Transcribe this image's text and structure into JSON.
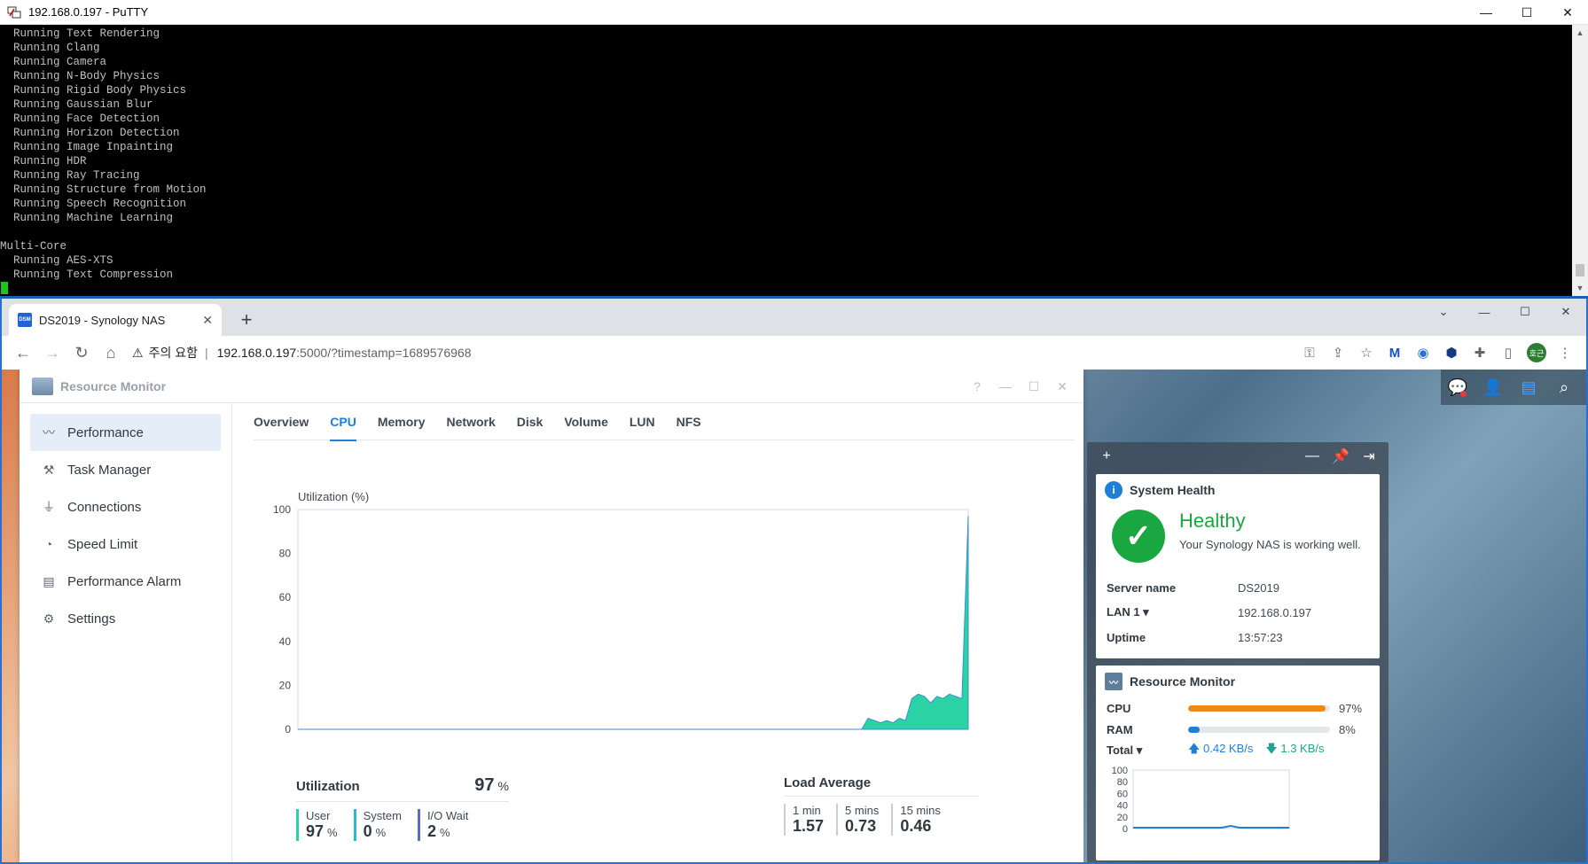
{
  "putty": {
    "title": "192.168.0.197 - PuTTY",
    "terminal_lines": [
      "  Running Text Rendering",
      "  Running Clang",
      "  Running Camera",
      "  Running N-Body Physics",
      "  Running Rigid Body Physics",
      "  Running Gaussian Blur",
      "  Running Face Detection",
      "  Running Horizon Detection",
      "  Running Image Inpainting",
      "  Running HDR",
      "  Running Ray Tracing",
      "  Running Structure from Motion",
      "  Running Speech Recognition",
      "  Running Machine Learning",
      "",
      "Multi-Core",
      "  Running AES-XTS",
      "  Running Text Compression"
    ],
    "controls": {
      "minimize": "—",
      "maximize": "☐",
      "close": "✕"
    }
  },
  "browser": {
    "tab_title": "DS2019 - Synology NAS",
    "tab_favicon": "DSM",
    "tab_close": "✕",
    "new_tab": "+",
    "security_warning": "주의 요함",
    "url_host": "192.168.0.197",
    "url_path": ":5000/?timestamp=1689576968",
    "profile_initials": "호근",
    "controls": {
      "tabsearch": "⌄",
      "minimize": "—",
      "maximize": "☐",
      "close": "✕"
    }
  },
  "resource_monitor": {
    "title": "Resource Monitor",
    "window_controls": {
      "help": "?",
      "minimize": "—",
      "maximize": "☐",
      "close": "✕"
    },
    "sidebar": [
      {
        "label": "Performance",
        "icon": "chart-icon",
        "active": true
      },
      {
        "label": "Task Manager",
        "icon": "task-icon",
        "active": false
      },
      {
        "label": "Connections",
        "icon": "plug-icon",
        "active": false
      },
      {
        "label": "Speed Limit",
        "icon": "gauge-icon",
        "active": false
      },
      {
        "label": "Performance Alarm",
        "icon": "alarm-icon",
        "active": false
      },
      {
        "label": "Settings",
        "icon": "gear-icon",
        "active": false
      }
    ],
    "tabs": [
      "Overview",
      "CPU",
      "Memory",
      "Network",
      "Disk",
      "Volume",
      "LUN",
      "NFS"
    ],
    "active_tab": "CPU",
    "utilization": {
      "label": "Utilization",
      "value": "97",
      "unit": "%",
      "user_label": "User",
      "user_value": "97",
      "user_unit": "%",
      "system_label": "System",
      "system_value": "0",
      "system_unit": "%",
      "iowait_label": "I/O Wait",
      "iowait_value": "2",
      "iowait_unit": "%"
    },
    "load_average": {
      "label": "Load Average",
      "items": [
        {
          "label": "1 min",
          "value": "1.57"
        },
        {
          "label": "5 mins",
          "value": "0.73"
        },
        {
          "label": "15 mins",
          "value": "0.46"
        }
      ]
    }
  },
  "widgets": {
    "system_health": {
      "title": "System Health",
      "status": "Healthy",
      "description": "Your Synology NAS is working well.",
      "server_name_label": "Server name",
      "server_name": "DS2019",
      "lan_label": "LAN 1 ▾",
      "lan_value": "192.168.0.197",
      "uptime_label": "Uptime",
      "uptime_value": "13:57:23"
    },
    "resource_monitor": {
      "title": "Resource Monitor",
      "cpu_label": "CPU",
      "cpu_value": "97%",
      "cpu_fraction": 0.97,
      "ram_label": "RAM",
      "ram_value": "8%",
      "ram_fraction": 0.08,
      "total_label": "Total ▾",
      "upload": "0.42 KB/s",
      "download": "1.3 KB/s",
      "chart_y_ticks": [
        "100",
        "80",
        "60",
        "40",
        "20",
        "0"
      ]
    }
  },
  "colors": {
    "accent": "#1f7fd6",
    "cpu_bar": "#f0891a",
    "ram_bar": "#1f7fd6",
    "user_series": "#2bd2a6",
    "system_series": "#3b8fd4",
    "healthy": "#1aa640"
  },
  "chart_data": {
    "type": "area",
    "ylabel": "Utilization (%)",
    "ylim": [
      0,
      100
    ],
    "yticks": [
      0,
      20,
      40,
      60,
      80,
      100
    ],
    "grid": false,
    "series": [
      {
        "values": [
          0,
          0,
          0,
          0,
          0,
          0,
          0,
          0,
          0,
          0,
          0,
          0,
          0,
          0,
          0,
          0,
          0,
          0,
          0,
          0,
          0,
          0,
          0,
          0,
          0,
          0,
          0,
          0,
          0,
          0,
          0,
          0,
          0,
          0,
          0,
          0,
          0,
          0,
          0,
          0,
          0,
          0,
          0,
          0,
          0,
          0,
          0,
          0,
          0,
          0,
          0,
          0,
          0,
          0,
          0,
          0,
          0,
          0,
          0,
          0,
          0,
          0,
          0,
          0,
          0,
          0,
          0,
          0,
          0,
          0,
          0,
          0,
          0,
          0,
          0,
          0,
          0,
          0,
          0,
          0,
          0,
          0,
          0,
          0,
          0,
          0,
          0,
          0,
          0,
          0,
          0,
          5,
          4,
          3,
          4,
          3,
          5,
          4,
          14,
          16,
          15,
          12,
          15,
          14,
          16,
          15,
          14,
          97
        ]
      }
    ]
  }
}
